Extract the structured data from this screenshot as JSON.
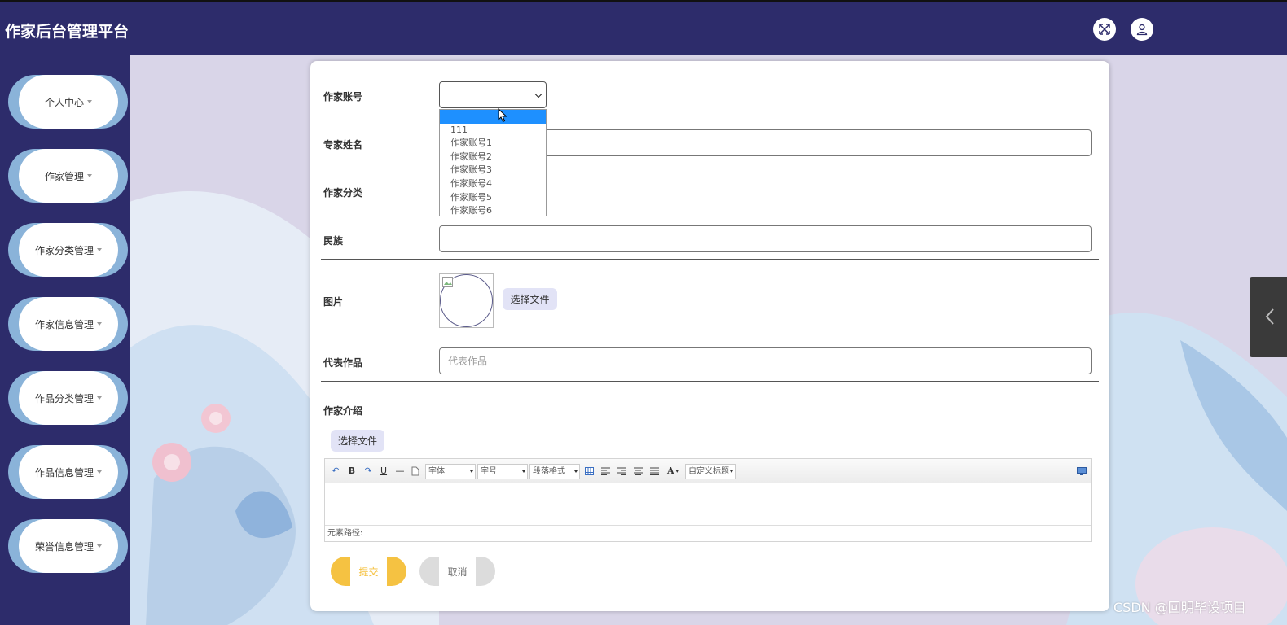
{
  "app": {
    "title": "作家后台管理平台"
  },
  "header": {
    "fullscreen_icon": "expand-icon",
    "user_icon": "user-icon"
  },
  "sidebar": {
    "items": [
      {
        "label": "个人中心"
      },
      {
        "label": "作家管理"
      },
      {
        "label": "作家分类管理"
      },
      {
        "label": "作家信息管理"
      },
      {
        "label": "作品分类管理"
      },
      {
        "label": "作品信息管理"
      },
      {
        "label": "荣誉信息管理"
      }
    ]
  },
  "form": {
    "account": {
      "label": "作家账号",
      "value": ""
    },
    "account_options": [
      "",
      "111",
      "作家账号1",
      "作家账号2",
      "作家账号3",
      "作家账号4",
      "作家账号5",
      "作家账号6"
    ],
    "name": {
      "label": "专家姓名",
      "value": ""
    },
    "category": {
      "label": "作家分类"
    },
    "ethnicity": {
      "label": "民族",
      "value": ""
    },
    "image": {
      "label": "图片",
      "button": "选择文件"
    },
    "works": {
      "label": "代表作品",
      "placeholder": "代表作品",
      "value": ""
    },
    "intro": {
      "label": "作家介绍",
      "button": "选择文件"
    },
    "editor": {
      "font_family": "字体",
      "font_size": "字号",
      "paragraph": "段落格式",
      "custom_title": "自定义标题",
      "path_label": "元素路径:"
    },
    "submit": "提交",
    "cancel": "取消"
  },
  "colors": {
    "header_bg": "#2d2c6b",
    "nav_accent": "#8ab3d9",
    "submit": "#f5c242",
    "cancel": "#dcdcdc",
    "dropdown_highlight": "#1e90ff"
  },
  "watermark": "CSDN @回明毕设项目"
}
